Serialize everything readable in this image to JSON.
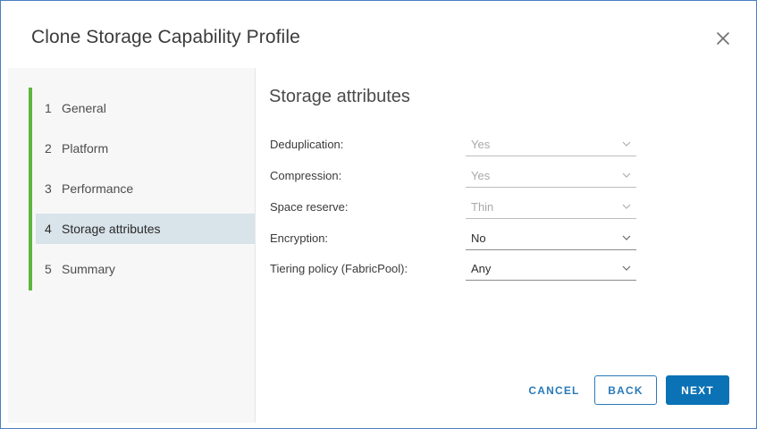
{
  "dialog": {
    "title": "Clone Storage Capability Profile",
    "close_icon": "close-icon"
  },
  "steps": [
    {
      "num": "1",
      "label": "General",
      "active": false
    },
    {
      "num": "2",
      "label": "Platform",
      "active": false
    },
    {
      "num": "3",
      "label": "Performance",
      "active": false
    },
    {
      "num": "4",
      "label": "Storage attributes",
      "active": true
    },
    {
      "num": "5",
      "label": "Summary",
      "active": false
    }
  ],
  "section": {
    "title": "Storage attributes"
  },
  "fields": [
    {
      "label": "Deduplication:",
      "value": "Yes",
      "disabled": true
    },
    {
      "label": "Compression:",
      "value": "Yes",
      "disabled": true
    },
    {
      "label": "Space reserve:",
      "value": "Thin",
      "disabled": true
    },
    {
      "label": "Encryption:",
      "value": "No",
      "disabled": false
    },
    {
      "label": "Tiering policy (FabricPool):",
      "value": "Any",
      "disabled": false
    }
  ],
  "buttons": {
    "cancel": "CANCEL",
    "back": "BACK",
    "next": "NEXT"
  },
  "colors": {
    "progress_bar": "#5eb53f",
    "active_step_bg": "#d8e3ea",
    "primary": "#0b72b5",
    "link": "#2a7ab8",
    "dialog_border": "#4a7fc1"
  }
}
